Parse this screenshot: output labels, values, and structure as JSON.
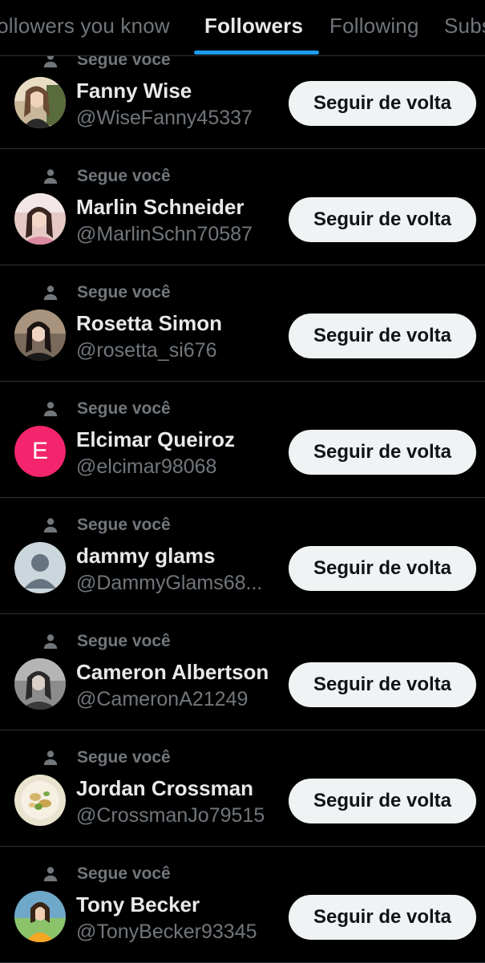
{
  "tabs": [
    {
      "label": "Followers you know",
      "active": false
    },
    {
      "label": "Followers",
      "active": true
    },
    {
      "label": "Following",
      "active": false
    },
    {
      "label": "Subscriptions",
      "active": false
    }
  ],
  "colors": {
    "accent": "#1d9bf0",
    "background": "#000000",
    "muted": "#71767b",
    "button_bg": "#eff3f4"
  },
  "followers": [
    {
      "follows_you": "Segue você",
      "name": "Fanny Wise",
      "handle": "@WiseFanny45337",
      "button": "Seguir de volta",
      "avatar": "photo"
    },
    {
      "follows_you": "Segue você",
      "name": "Marlin Schneider",
      "handle": "@MarlinSchn70587",
      "button": "Seguir de volta",
      "avatar": "photo"
    },
    {
      "follows_you": "Segue você",
      "name": "Rosetta Simon",
      "handle": "@rosetta_si676",
      "button": "Seguir de volta",
      "avatar": "photo"
    },
    {
      "follows_you": "Segue você",
      "name": "Elcimar Queiroz",
      "handle": "@elcimar98068",
      "button": "Seguir de volta",
      "avatar": "letter",
      "letter": "E",
      "avatar_color": "#f4256d"
    },
    {
      "follows_you": "Segue você",
      "name": "dammy glams",
      "handle": "@DammyGlams68...",
      "button": "Seguir de volta",
      "avatar": "default"
    },
    {
      "follows_you": "Segue você",
      "name": "Cameron Albertson",
      "handle": "@CameronA21249",
      "button": "Seguir de volta",
      "avatar": "photo"
    },
    {
      "follows_you": "Segue você",
      "name": "Jordan Crossman",
      "handle": "@CrossmanJo79515",
      "button": "Seguir de volta",
      "avatar": "photo"
    },
    {
      "follows_you": "Segue você",
      "name": "Tony Becker",
      "handle": "@TonyBecker93345",
      "button": "Seguir de volta",
      "avatar": "photo"
    }
  ]
}
